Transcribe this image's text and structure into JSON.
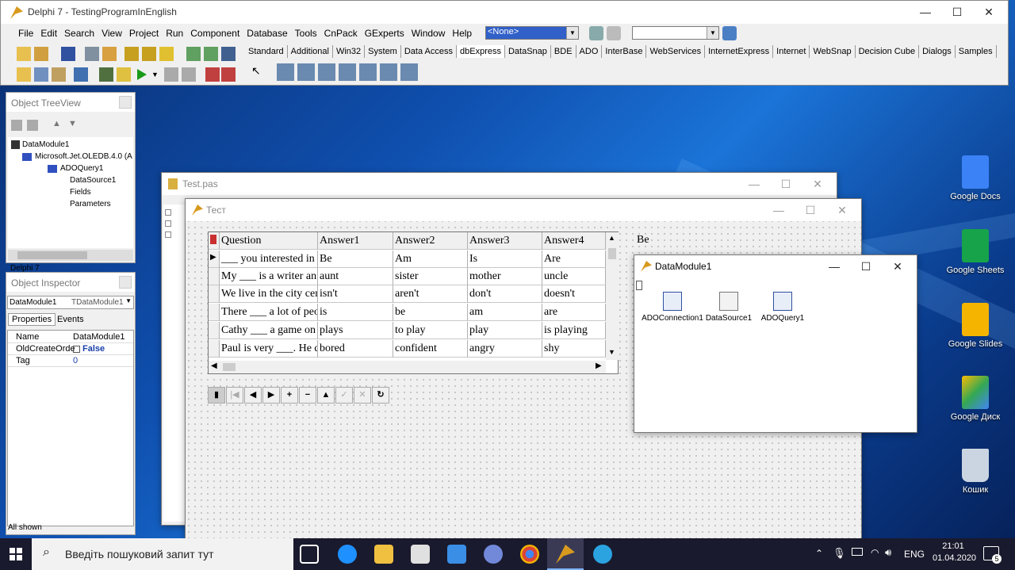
{
  "ide": {
    "title": "Delphi 7 - TestingProgramInEnglish",
    "menu": [
      "File",
      "Edit",
      "Search",
      "View",
      "Project",
      "Run",
      "Component",
      "Database",
      "Tools",
      "CnPack",
      "GExperts",
      "Window",
      "Help"
    ],
    "combo_value": "<None>",
    "palette_tabs": [
      "Standard",
      "Additional",
      "Win32",
      "System",
      "Data Access",
      "dbExpress",
      "DataSnap",
      "BDE",
      "ADO",
      "InterBase",
      "WebServices",
      "InternetExpress",
      "Internet",
      "WebSnap",
      "Decision Cube",
      "Dialogs",
      "Samples"
    ],
    "active_tab": "dbExpress"
  },
  "treeview": {
    "title": "Object TreeView",
    "items": [
      "DataModule1",
      "Microsoft.Jet.OLEDB.4.0 (A",
      "ADOQuery1",
      "DataSource1",
      "Fields",
      "Parameters"
    ],
    "footer": "Delphi 7"
  },
  "inspector": {
    "title": "Object Inspector",
    "object": "DataModule1",
    "object_type": "TDataModule1",
    "tabs": [
      "Properties",
      "Events"
    ],
    "props": [
      {
        "name": "Name",
        "value": "DataModule1"
      },
      {
        "name": "OldCreateOrde",
        "value": "False"
      },
      {
        "name": "Tag",
        "value": "0"
      }
    ],
    "status": "All shown"
  },
  "editor": {
    "title": "Test.pas"
  },
  "form": {
    "title": "Тест",
    "label": "Be",
    "grid": {
      "columns": [
        "Question",
        "Answer1",
        "Answer2",
        "Answer3",
        "Answer4"
      ],
      "rows": [
        [
          "___ you interested in",
          "Be",
          "Am",
          "Is",
          "Are"
        ],
        [
          "My ___ is a writer an",
          "aunt",
          "sister",
          "mother",
          "uncle"
        ],
        [
          "We live in the city cer",
          "isn't",
          "aren't",
          "don't",
          "doesn't"
        ],
        [
          "There ___ a lot of peo",
          "is",
          "be",
          "am",
          "are"
        ],
        [
          "Cathy ___ a game on",
          "plays",
          "to play",
          "play",
          "is playing"
        ],
        [
          "Paul is very ___. He d",
          "bored",
          "confident",
          "angry",
          "shy"
        ]
      ]
    },
    "navigator": [
      "|◀",
      "◀",
      "▶",
      "▶|",
      "+",
      "−",
      "▲",
      "✓",
      "✕",
      "↻"
    ]
  },
  "datamodule": {
    "title": "DataModule1",
    "components": [
      "ADOConnection1",
      "DataSource1",
      "ADOQuery1"
    ]
  },
  "desktop_icons": [
    {
      "label": "Google Docs",
      "color": "#3b82f6"
    },
    {
      "label": "Google Sheets",
      "color": "#16a34a"
    },
    {
      "label": "Google Slides",
      "color": "#f5b400"
    },
    {
      "label": "Google Диск",
      "color": "#fbbc04"
    },
    {
      "label": "Кошик",
      "color": "#cbd5e1"
    }
  ],
  "taskbar": {
    "search_placeholder": "Введіть пошуковий запит тут",
    "lang": "ENG",
    "time": "21:01",
    "date": "01.04.2020",
    "notifications": "5"
  }
}
